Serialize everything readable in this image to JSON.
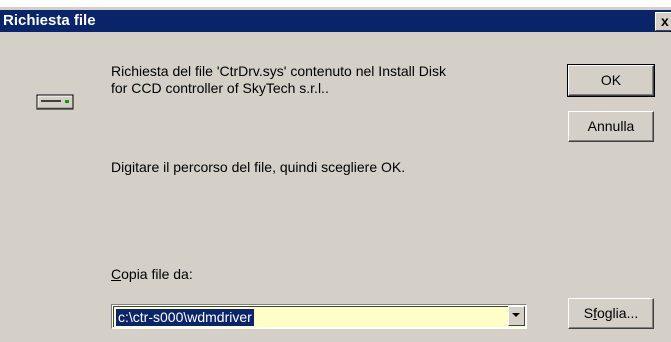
{
  "dialog": {
    "title": "Richiesta file",
    "close_label": "x",
    "message_line1": "Richiesta del file 'CtrDrv.sys' contenuto nel Install Disk",
    "message_line2": "for CCD controller of SkyTech s.r.l..",
    "instruction": "Digitare il percorso del file, quindi scegliere OK.",
    "copy_label_accel": "C",
    "copy_label_rest": "opia file da:",
    "path_value": "c:\\ctr-s000\\wdmdriver",
    "ok_label": "OK",
    "cancel_label": "Annulla",
    "browse_label_pre": "S",
    "browse_label_accel": "f",
    "browse_label_rest": "oglia..."
  },
  "icons": {
    "disk": "disk-drive-icon",
    "close": "close-icon",
    "dropdown": "chevron-down-icon"
  },
  "colors": {
    "face": "#d4d0c8",
    "titlebar": "#0a246a",
    "selection": "#0a246a",
    "combo_bg": "#ffffc8"
  }
}
